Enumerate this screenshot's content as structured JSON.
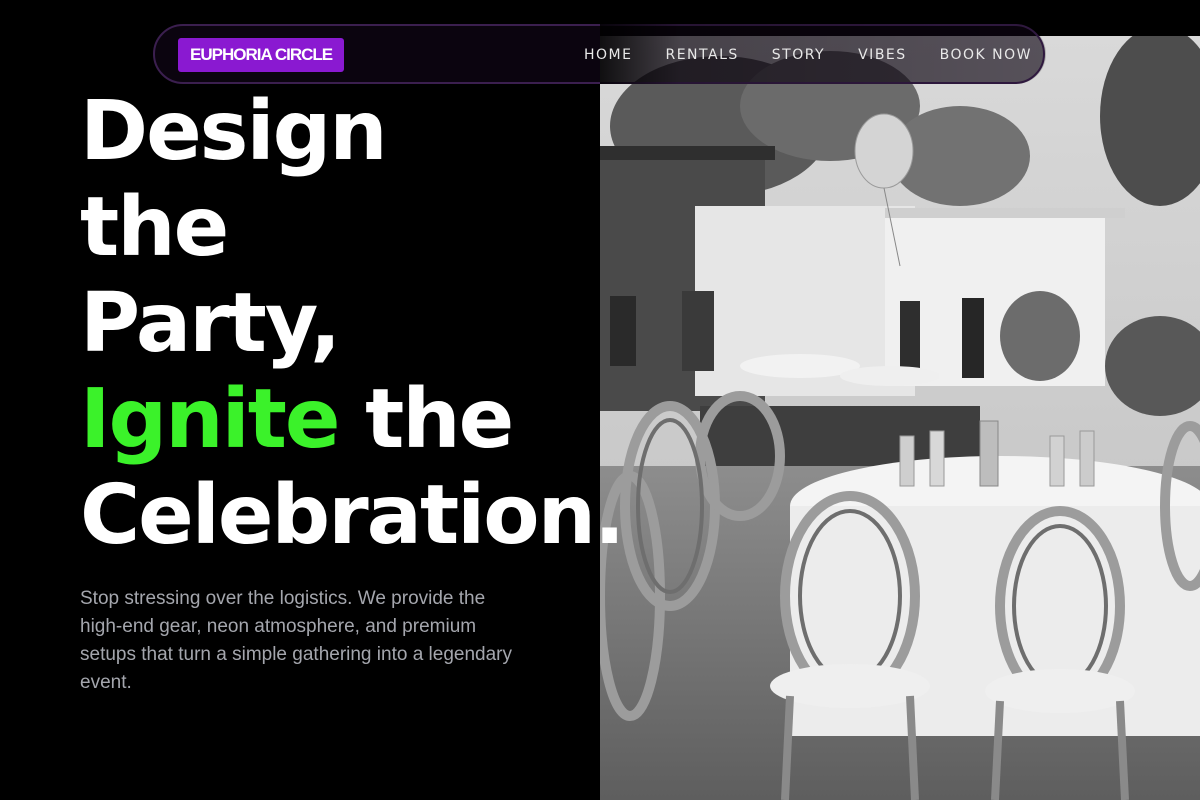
{
  "brand": {
    "logo_text": "EUPHORIA CIRCLE",
    "accent": "#8a19d1",
    "highlight": "#3bf22a"
  },
  "nav": {
    "items": [
      {
        "label": "HOME"
      },
      {
        "label": "RENTALS"
      },
      {
        "label": "STORY"
      },
      {
        "label": "VIBES"
      },
      {
        "label": "BOOK NOW"
      }
    ]
  },
  "hero": {
    "line1": "Design",
    "line2": "the",
    "line3": "Party,",
    "line4_accent": "Ignite",
    "line4_rest": " the",
    "line5": "Celebration.",
    "lead": "Stop stressing over the logistics. We provide the high-end gear, neon atmosphere, and premium setups that turn a simple gathering into a legendary event."
  },
  "photo": {
    "subject": "outdoor party venue with round tables, chairs and balloons (grayscale)"
  }
}
